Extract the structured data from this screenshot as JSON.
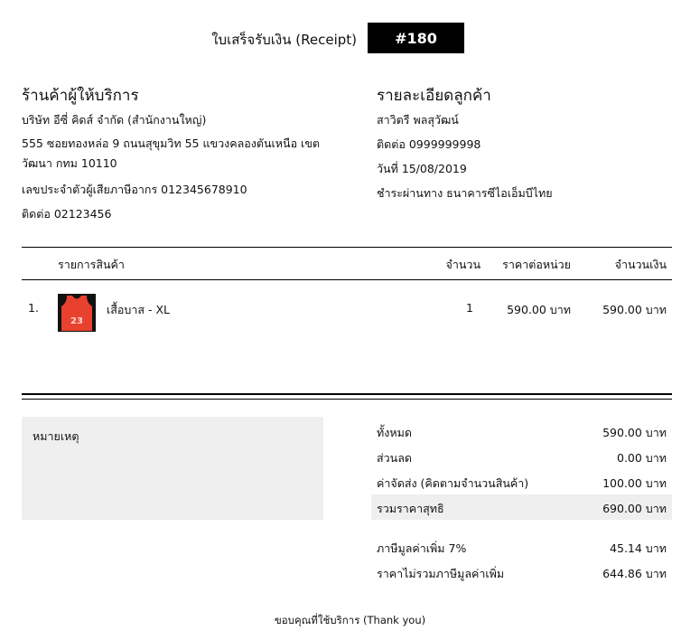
{
  "receipt": {
    "title": "ใบเสร็จรับเงิน (Receipt)",
    "number": "#180"
  },
  "seller": {
    "heading": "ร้านค้าผู้ให้บริการ",
    "company": "บริษัท อีซี่ คิดส์ จำกัด (สำนักงานใหญ่)",
    "address": "555 ซอยทองหล่อ 9 ถนนสุขุมวิท 55 แขวงคลองตันเหนือ เขตวัฒนา กทม 10110",
    "tax_id": "เลขประจำตัวผู้เสียภาษีอากร 012345678910",
    "contact": "ติดต่อ 02123456"
  },
  "customer": {
    "heading": "รายละเอียดลูกค้า",
    "name": "สาวิตรี พลสุวัฒน์",
    "contact": "ติดต่อ 0999999998",
    "date": "วันที่  15/08/2019",
    "payment": "ชำระผ่านทาง ธนาคารซีไอเอ็มบีไทย"
  },
  "table": {
    "headers": {
      "item": "รายการสินค้า",
      "qty": "จำนวน",
      "unit_price": "ราคาต่อหน่วย",
      "amount": "จำนวนเงิน"
    },
    "rows": [
      {
        "index": "1.",
        "product_name": "เสื้อบาส - XL",
        "jersey_number": "23",
        "qty": "1",
        "unit_price": "590.00 บาท",
        "amount": "590.00 บาท"
      }
    ]
  },
  "note": {
    "label": "หมายเหตุ"
  },
  "summary": {
    "subtotal_label": "ทั้งหมด",
    "subtotal_value": "590.00 บาท",
    "discount_label": "ส่วนลด",
    "discount_value": "0.00 บาท",
    "shipping_label": "ค่าจัดส่ง    (คิดตามจำนวนสินค้า)",
    "shipping_value": "100.00 บาท",
    "net_label": "รวมราคาสุทธิ",
    "net_value": "690.00 บาท",
    "vat_label": "ภาษีมูลค่าเพิ่ม 7%",
    "vat_value": "45.14 บาท",
    "pre_vat_label": "ราคาไม่รวมภาษีมูลค่าเพิ่ม",
    "pre_vat_value": "644.86 บาท"
  },
  "footer": {
    "thanks": "ขอบคุณที่ใช้บริการ (Thank you)"
  },
  "colors": {
    "badge_bg": "#000000",
    "panel_gray": "#efefef",
    "jersey_red": "#e8412e"
  },
  "icons": {
    "product_image": "basketball-jersey-icon"
  }
}
